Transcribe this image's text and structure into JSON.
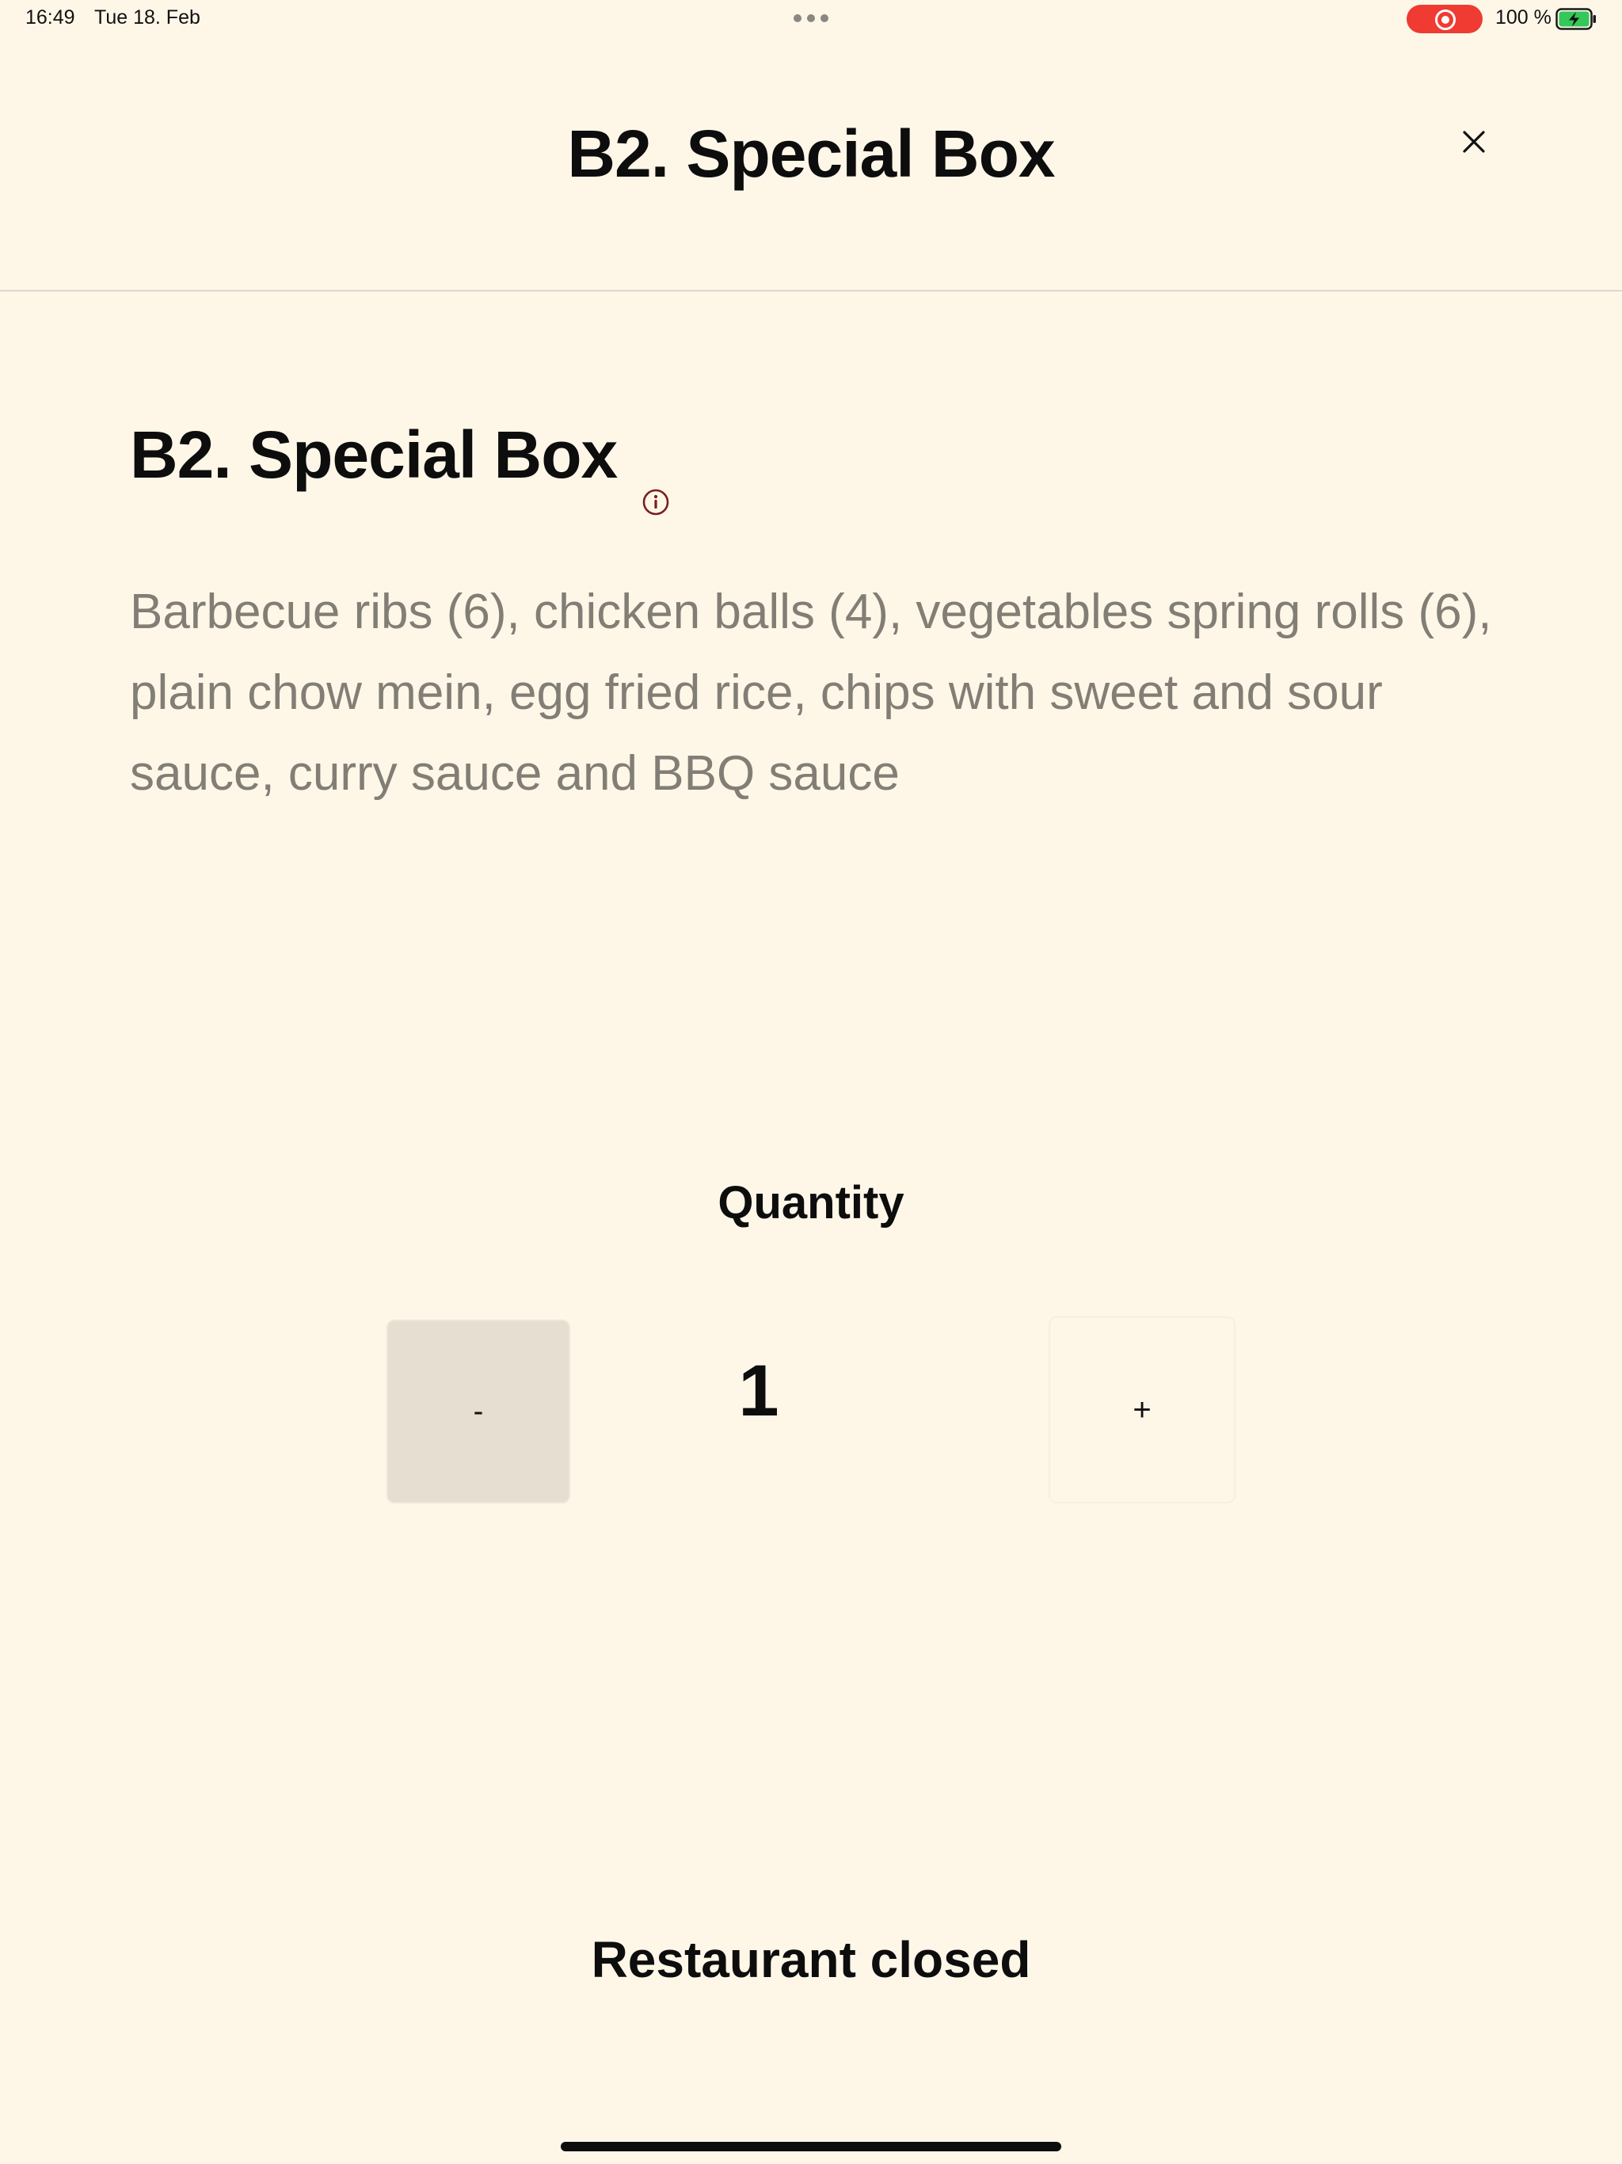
{
  "status_bar": {
    "time": "16:49",
    "date": "Tue 18. Feb",
    "battery_label": "100 %",
    "record_color": "#ef3b32",
    "battery_color": "#34c759"
  },
  "header": {
    "title": "B2. Special Box",
    "close_icon": "close-icon"
  },
  "item": {
    "title": "B2. Special Box",
    "info_icon": "info-icon",
    "info_icon_color": "#7a1e1e",
    "description": "Barbecue ribs (6), chicken balls (4), vegetables spring rolls (6), plain chow mein, egg fried rice, chips with sweet and sour sauce, curry sauce and BBQ sauce"
  },
  "quantity": {
    "label": "Quantity",
    "decrement_label": "-",
    "value": "1",
    "increment_label": "+"
  },
  "footer": {
    "status": "Restaurant closed"
  },
  "colors": {
    "background": "#fef7e8",
    "description_text": "#837e75",
    "minus_button_bg": "#e6ded0"
  }
}
